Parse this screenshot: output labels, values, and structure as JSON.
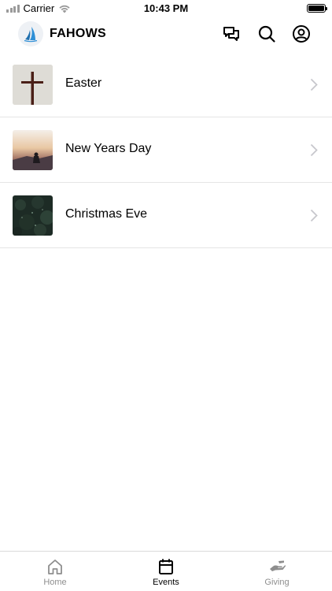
{
  "status": {
    "carrier": "Carrier",
    "time": "10:43 PM"
  },
  "header": {
    "brand": "FAHOWS",
    "icons": [
      "chat-icon",
      "search-icon",
      "profile-icon"
    ]
  },
  "events": [
    {
      "title": "Easter",
      "thumb": "cross-photo"
    },
    {
      "title": "New Years Day",
      "thumb": "sunset-photo"
    },
    {
      "title": "Christmas Eve",
      "thumb": "pine-photo"
    }
  ],
  "tabs": [
    {
      "label": "Home",
      "icon": "home-icon",
      "active": false
    },
    {
      "label": "Events",
      "icon": "calendar-icon",
      "active": true
    },
    {
      "label": "Giving",
      "icon": "giving-icon",
      "active": false
    }
  ],
  "colors": {
    "active_tab": "#000000",
    "inactive_tab": "#8e8e8e",
    "separator": "#e5e5e5",
    "logo_blue": "#2e8fd6"
  }
}
